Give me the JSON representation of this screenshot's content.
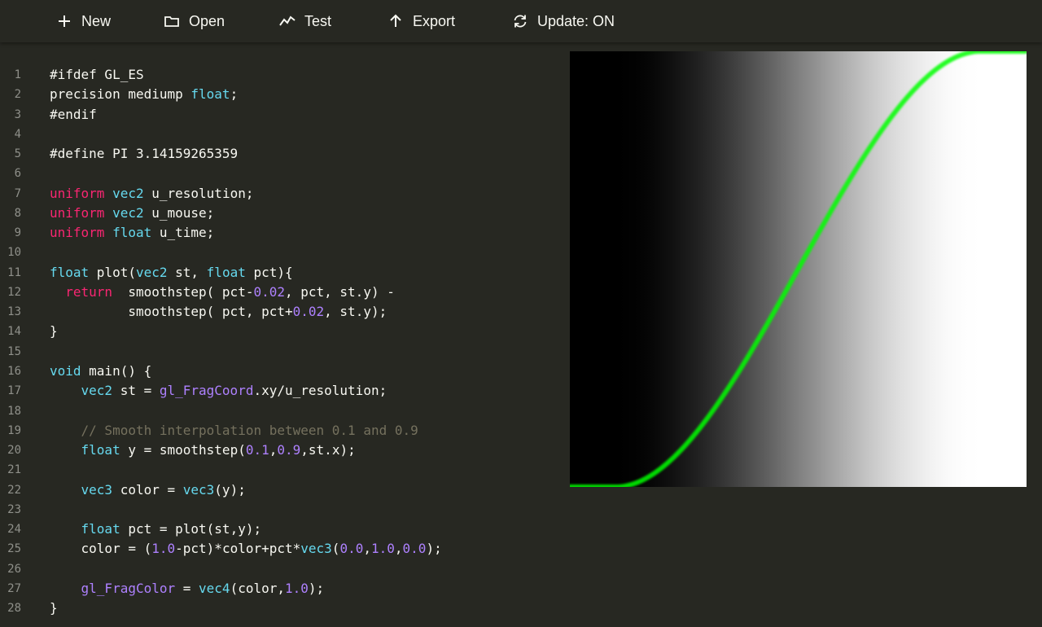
{
  "toolbar": {
    "items": [
      {
        "label": "New",
        "icon": "plus-icon"
      },
      {
        "label": "Open",
        "icon": "folder-icon"
      },
      {
        "label": "Test",
        "icon": "line-graph-icon"
      },
      {
        "label": "Export",
        "icon": "arrow-up-icon"
      },
      {
        "label": "Update: ON",
        "icon": "refresh-icon"
      }
    ]
  },
  "editor": {
    "lines": [
      [
        {
          "t": "p",
          "s": "#ifdef GL_ES"
        }
      ],
      [
        {
          "t": "p",
          "s": "precision mediump "
        },
        {
          "t": "t",
          "s": "float"
        },
        {
          "t": "p",
          "s": ";"
        }
      ],
      [
        {
          "t": "p",
          "s": "#endif"
        }
      ],
      [],
      [
        {
          "t": "p",
          "s": "#define PI 3.14159265359"
        }
      ],
      [],
      [
        {
          "t": "k",
          "s": "uniform"
        },
        {
          "t": "p",
          "s": " "
        },
        {
          "t": "t",
          "s": "vec2"
        },
        {
          "t": "p",
          "s": " u_resolution;"
        }
      ],
      [
        {
          "t": "k",
          "s": "uniform"
        },
        {
          "t": "p",
          "s": " "
        },
        {
          "t": "t",
          "s": "vec2"
        },
        {
          "t": "p",
          "s": " u_mouse;"
        }
      ],
      [
        {
          "t": "k",
          "s": "uniform"
        },
        {
          "t": "p",
          "s": " "
        },
        {
          "t": "t",
          "s": "float"
        },
        {
          "t": "p",
          "s": " u_time;"
        }
      ],
      [],
      [
        {
          "t": "t",
          "s": "float"
        },
        {
          "t": "p",
          "s": " plot("
        },
        {
          "t": "t",
          "s": "vec2"
        },
        {
          "t": "p",
          "s": " st, "
        },
        {
          "t": "t",
          "s": "float"
        },
        {
          "t": "p",
          "s": " pct){"
        }
      ],
      [
        {
          "t": "p",
          "s": "  "
        },
        {
          "t": "k",
          "s": "return"
        },
        {
          "t": "p",
          "s": "  smoothstep( pct-"
        },
        {
          "t": "n",
          "s": "0.02"
        },
        {
          "t": "p",
          "s": ", pct, st.y) -"
        }
      ],
      [
        {
          "t": "p",
          "s": "          smoothstep( pct, pct+"
        },
        {
          "t": "n",
          "s": "0.02"
        },
        {
          "t": "p",
          "s": ", st.y);"
        }
      ],
      [
        {
          "t": "p",
          "s": "}"
        }
      ],
      [],
      [
        {
          "t": "t",
          "s": "void"
        },
        {
          "t": "p",
          "s": " main() {"
        }
      ],
      [
        {
          "t": "p",
          "s": "    "
        },
        {
          "t": "t",
          "s": "vec2"
        },
        {
          "t": "p",
          "s": " st = "
        },
        {
          "t": "b",
          "s": "gl_FragCoord"
        },
        {
          "t": "p",
          "s": ".xy/u_resolution;"
        }
      ],
      [],
      [
        {
          "t": "p",
          "s": "    "
        },
        {
          "t": "c",
          "s": "// Smooth interpolation between 0.1 and 0.9"
        }
      ],
      [
        {
          "t": "p",
          "s": "    "
        },
        {
          "t": "t",
          "s": "float"
        },
        {
          "t": "p",
          "s": " y = smoothstep("
        },
        {
          "t": "n",
          "s": "0.1"
        },
        {
          "t": "p",
          "s": ","
        },
        {
          "t": "n",
          "s": "0.9"
        },
        {
          "t": "p",
          "s": ",st.x);"
        }
      ],
      [],
      [
        {
          "t": "p",
          "s": "    "
        },
        {
          "t": "t",
          "s": "vec3"
        },
        {
          "t": "p",
          "s": " color = "
        },
        {
          "t": "t",
          "s": "vec3"
        },
        {
          "t": "p",
          "s": "(y);"
        }
      ],
      [],
      [
        {
          "t": "p",
          "s": "    "
        },
        {
          "t": "t",
          "s": "float"
        },
        {
          "t": "p",
          "s": " pct = plot(st,y);"
        }
      ],
      [
        {
          "t": "p",
          "s": "    color = ("
        },
        {
          "t": "n",
          "s": "1.0"
        },
        {
          "t": "p",
          "s": "-pct)*color+pct*"
        },
        {
          "t": "t",
          "s": "vec3"
        },
        {
          "t": "p",
          "s": "("
        },
        {
          "t": "n",
          "s": "0.0"
        },
        {
          "t": "p",
          "s": ","
        },
        {
          "t": "n",
          "s": "1.0"
        },
        {
          "t": "p",
          "s": ","
        },
        {
          "t": "n",
          "s": "0.0"
        },
        {
          "t": "p",
          "s": ");"
        }
      ],
      [],
      [
        {
          "t": "p",
          "s": "    "
        },
        {
          "t": "b",
          "s": "gl_FragColor"
        },
        {
          "t": "p",
          "s": " = "
        },
        {
          "t": "t",
          "s": "vec4"
        },
        {
          "t": "p",
          "s": "(color,"
        },
        {
          "t": "n",
          "s": "1.0"
        },
        {
          "t": "p",
          "s": ");"
        }
      ],
      [
        {
          "t": "p",
          "s": "}"
        }
      ]
    ]
  },
  "preview": {
    "edge0": 0.1,
    "edge1": 0.9,
    "line_width": 0.02,
    "line_color": "#00ff00",
    "background_from": "#000000",
    "background_to": "#ffffff"
  },
  "theme": {
    "background": "#272822",
    "text": "#f8f8f2",
    "keyword": "#f92672",
    "type": "#66d9ef",
    "number": "#ae81ff",
    "comment": "#75715e",
    "line_number": "#8f908a"
  }
}
